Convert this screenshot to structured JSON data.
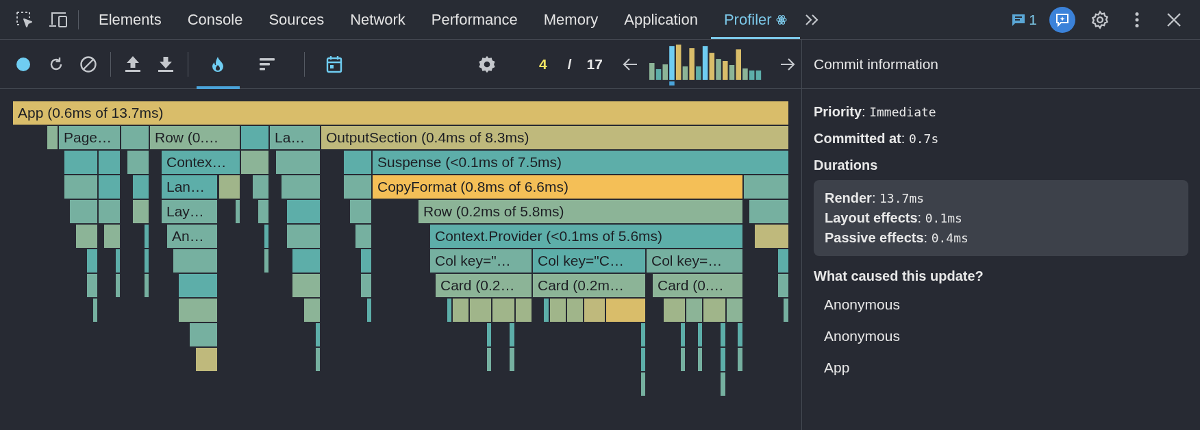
{
  "tabs": [
    {
      "kind": "plain",
      "label": "Elements",
      "selected": false
    },
    {
      "kind": "plain",
      "label": "Console",
      "selected": false
    },
    {
      "kind": "plain",
      "label": "Sources",
      "selected": false
    },
    {
      "kind": "plain",
      "label": "Network",
      "selected": false
    },
    {
      "kind": "plain",
      "label": "Performance",
      "selected": false
    },
    {
      "kind": "plain",
      "label": "Memory",
      "selected": false
    },
    {
      "kind": "plain",
      "label": "Application",
      "selected": false
    },
    {
      "kind": "react",
      "label": "Profiler",
      "selected": true
    }
  ],
  "issues": {
    "count": "1"
  },
  "toolbar": {
    "view_modes": [
      {
        "kind": "flame",
        "selected": true
      },
      {
        "kind": "ranked",
        "selected": false
      }
    ],
    "commit": {
      "current": "4",
      "separator": "/",
      "total": "17"
    }
  },
  "flame_graph": {
    "nodes": [
      {
        "label": "App (0.6ms of 13.7ms)",
        "color": "#d9bd6a",
        "children": [
          {
            "label": "Page…",
            "color": "#76b0a0"
          },
          {
            "label": "Row (0.…",
            "color": "#8cb497",
            "children": [
              {
                "label": "Contex…",
                "color": "#5daea9",
                "children": [
                  {
                    "label": "Lan…",
                    "color": "#5daea9",
                    "children": [
                      {
                        "label": "Lay…",
                        "color": "#76b0a0",
                        "children": [
                          {
                            "label": "An…",
                            "color": "#76b0a0"
                          }
                        ]
                      }
                    ]
                  }
                ]
              }
            ]
          },
          {
            "label": "La…",
            "color": "#76b0a0"
          },
          {
            "label": "OutputSection (0.4ms of 8.3ms)",
            "color": "#bfb97c",
            "children": [
              {
                "label": "Suspense (<0.1ms of 7.5ms)",
                "color": "#5daea9",
                "children": [
                  {
                    "label": "CopyFormat (0.8ms of 6.6ms)",
                    "color": "#f4bf57",
                    "children": [
                      {
                        "label": "Row (0.2ms of 5.8ms)",
                        "color": "#8cb497",
                        "children": [
                          {
                            "label": "Context.Provider (<0.1ms of 5.6ms)",
                            "color": "#5daea9",
                            "children": [
                              {
                                "label": "Col key=\"…",
                                "color": "#76b0a0",
                                "children": [
                                  {
                                    "label": "Card (0.2…",
                                    "color": "#8cb497"
                                  }
                                ]
                              },
                              {
                                "label": "Col key=\"C…",
                                "color": "#5daea9",
                                "children": [
                                  {
                                    "label": "Card (0.2m…",
                                    "color": "#8cb497"
                                  }
                                ]
                              },
                              {
                                "label": "Col key=…",
                                "color": "#76b0a0",
                                "children": [
                                  {
                                    "label": "Card (0.…",
                                    "color": "#8cb497"
                                  }
                                ]
                              }
                            ]
                          }
                        ]
                      }
                    ]
                  }
                ]
              }
            ]
          }
        ]
      }
    ]
  },
  "commit_info": {
    "title": "Commit information",
    "fields": [
      {
        "label": "**Priority**:",
        "value": "Immediate"
      },
      {
        "label": "**Committed at**:",
        "value": "0.7s"
      }
    ],
    "durations": {
      "title": "Durations",
      "items": [
        {
          "label": "**Render**:",
          "value": "13.7ms"
        },
        {
          "label": "**Layout effects**:",
          "value": "0.1ms"
        },
        {
          "label": "**Passive effects**:",
          "value": "0.4ms"
        }
      ]
    },
    "causes": {
      "title": "What caused this update?",
      "items": [
        "Anonymous",
        "Anonymous",
        "App"
      ]
    }
  }
}
